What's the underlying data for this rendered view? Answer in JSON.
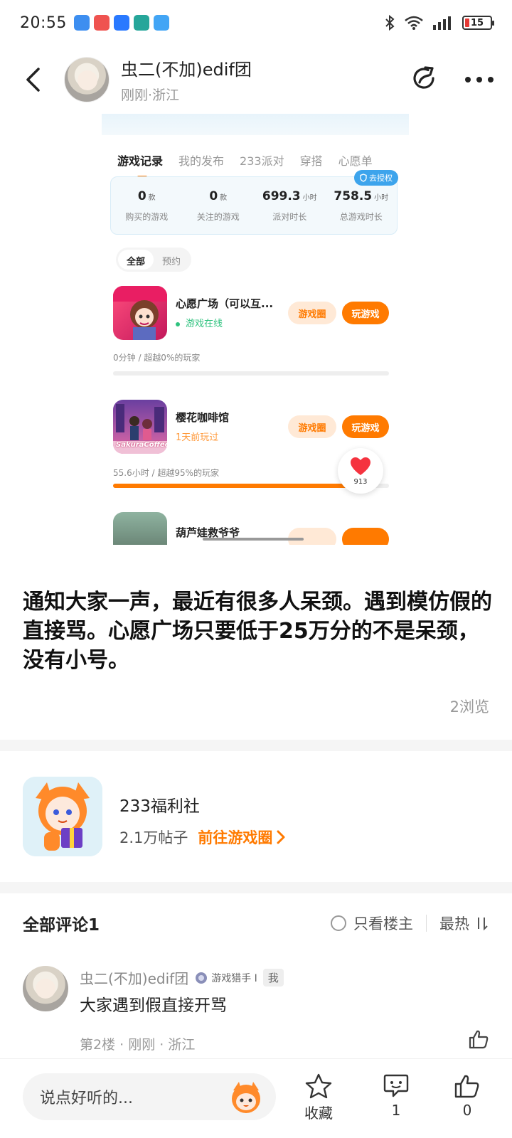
{
  "status_bar": {
    "time": "20:55",
    "battery": "15"
  },
  "header": {
    "user_name": "虫二(不加)edif团",
    "user_meta": "刚刚·浙江",
    "icons": [
      "back-arrow-icon",
      "share-icon",
      "more-icon"
    ]
  },
  "embedded_screenshot": {
    "tabs": [
      "游戏记录",
      "我的发布",
      "233派对",
      "穿搭",
      "心愿单"
    ],
    "active_tab": "游戏记录",
    "auth_badge": "去授权",
    "stats": [
      {
        "value": "0",
        "unit": "款",
        "label": "购买的游戏"
      },
      {
        "value": "0",
        "unit": "款",
        "label": "关注的游戏"
      },
      {
        "value": "699.3",
        "unit": "小时",
        "label": "派对时长"
      },
      {
        "value": "758.5",
        "unit": "小时",
        "label": "总游戏时长"
      }
    ],
    "filters": [
      "全部",
      "预约"
    ],
    "games": [
      {
        "name": "心愿广场（可以互...",
        "status": "游戏在线",
        "circle_btn": "游戏圈",
        "play_btn": "玩游戏",
        "meta": "0分钟 / 超越0%的玩家",
        "progress": 0.0
      },
      {
        "name": "樱花咖啡馆",
        "status": "1天前玩过",
        "circle_btn": "游戏圈",
        "play_btn": "玩游戏",
        "meta": "55.6小时 / 超越95%的玩家",
        "progress": 0.95,
        "icon_text": "SakuraCoffee"
      },
      {
        "name": "葫芦娃救爷爷"
      }
    ],
    "like_count": "913"
  },
  "post": {
    "text": "通知大家一声，最近有很多人呆颈。遇到模仿假的直接骂。心愿广场只要低于25万分的不是呆颈，没有小号。",
    "views": "2浏览"
  },
  "circle": {
    "name": "233福利社",
    "posts": "2.1万帖子",
    "go_label": "前往游戏圈"
  },
  "comments": {
    "title": "全部评论1",
    "only_op": "只看楼主",
    "sort": "最热",
    "items": [
      {
        "name": "虫二(不加)edif团",
        "badge": "游戏猎手 I",
        "me_tag": "我",
        "text": "大家遇到假直接开骂",
        "meta": "第2楼 · 刚刚 · 浙江"
      }
    ]
  },
  "bottom_bar": {
    "input_placeholder": "说点好听的...",
    "favorite_label": "收藏",
    "comment_count": "1",
    "like_count": "0"
  },
  "colors": {
    "accent": "#ff7a00",
    "accent_light": "#ffe9d6",
    "auth_blue": "#3da4ec",
    "online_green": "#2ec27e"
  }
}
